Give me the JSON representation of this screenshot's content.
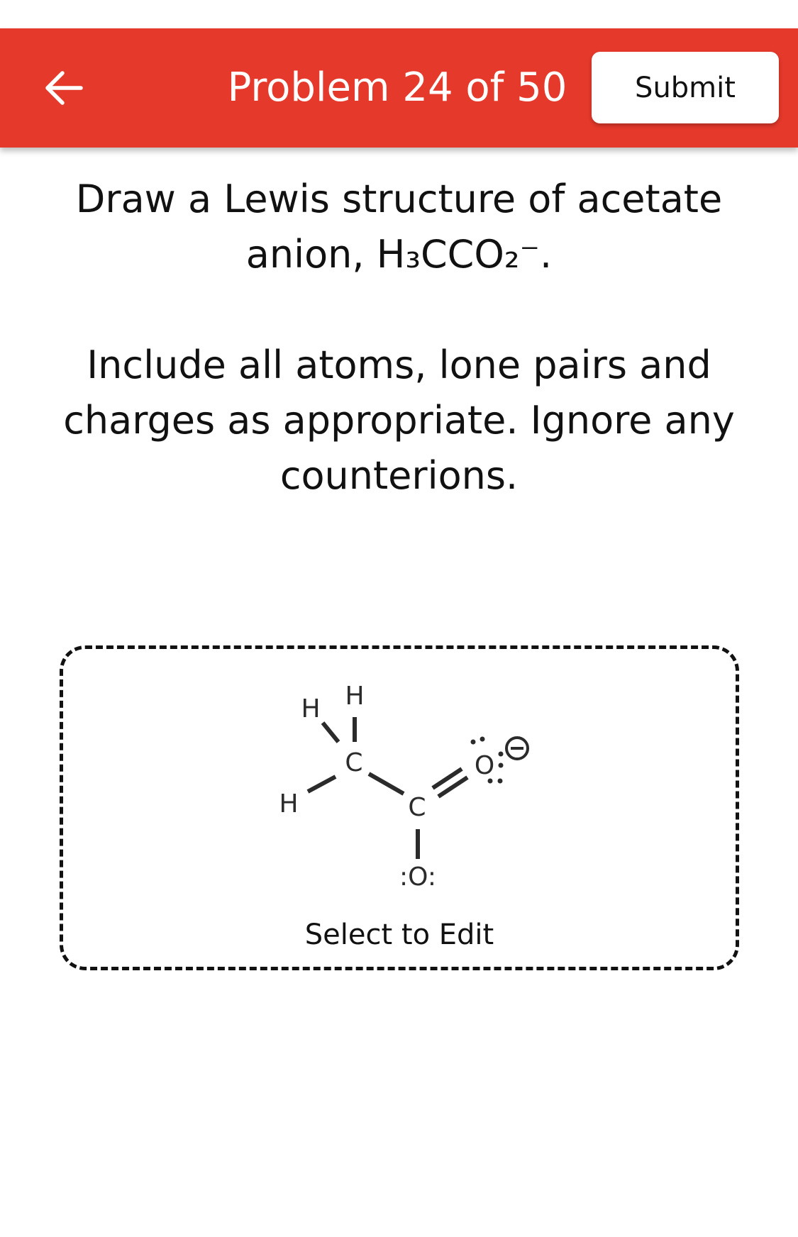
{
  "header": {
    "title": "Problem 24 of 50",
    "submit_label": "Submit",
    "back_icon": "arrow-left-icon",
    "background_color": "#e5392b"
  },
  "question": {
    "line1": "Draw a Lewis structure of acetate anion, H₃CCO₂⁻.",
    "line2": "Include all atoms, lone pairs and charges as appropriate. Ignore any counterions."
  },
  "drawing": {
    "atoms": {
      "h_top": "H",
      "h_upper_left": "H",
      "h_left": "H",
      "c_methyl": "C",
      "c_carboxyl": "C",
      "o_double": "O",
      "o_single": ":O:",
      "charge": "−"
    },
    "select_label": "Select to Edit"
  }
}
